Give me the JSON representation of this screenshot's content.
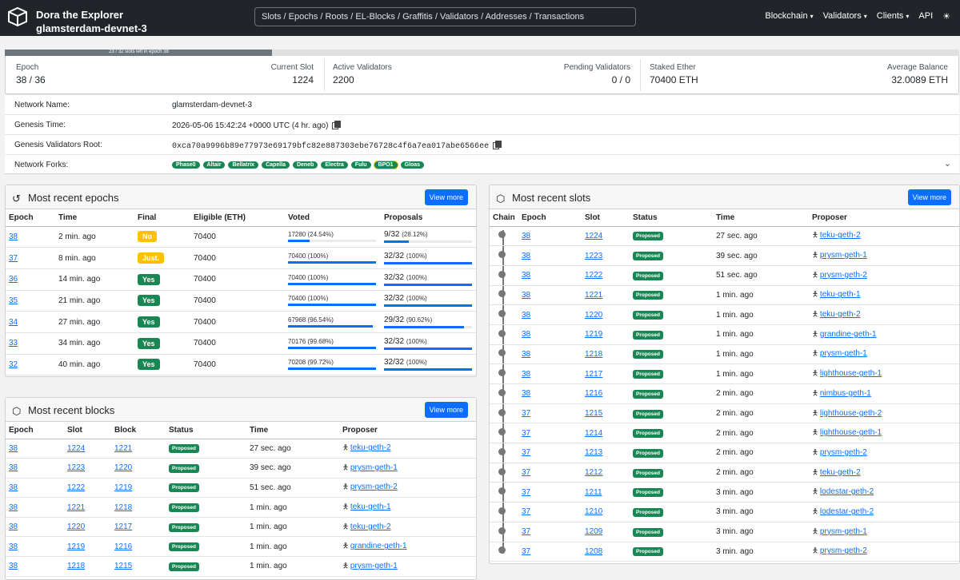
{
  "navbar": {
    "title": "Dora the Explorer",
    "network": "glamsterdam-devnet-3",
    "search_placeholder": "Slots / Epochs / Roots / EL-Blocks / Graffitis / Validators / Addresses / Transactions",
    "links": [
      "Blockchain",
      "Validators",
      "Clients",
      "API"
    ]
  },
  "epoch_progress": {
    "text": "23 / 32 slots left in epoch 38",
    "fraction": 0.28
  },
  "summary": {
    "epoch_label": "Epoch",
    "epoch_value": "38 / 36",
    "slot_label": "Current Slot",
    "slot_value": "1224",
    "active_label": "Active Validators",
    "active_value": "2200",
    "pending_label": "Pending Validators",
    "pending_value": "0 / 0",
    "staked_label": "Staked Ether",
    "staked_value": "70400 ETH",
    "balance_label": "Average Balance",
    "balance_value": "32.0089 ETH"
  },
  "network_info": {
    "name_label": "Network Name:",
    "name_value": "glamsterdam-devnet-3",
    "genesis_label": "Genesis Time:",
    "genesis_value": "2026-05-06 15:42:24 +0000 UTC (4 hr. ago)",
    "root_label": "Genesis Validators Root:",
    "root_value": "0xca70a9996b89e77973e69179bfc82e887303ebe76728c4f6a7ea017abe6566ee",
    "forks_label": "Network Forks:",
    "forks": [
      "Phase0",
      "Altair",
      "Bellatrix",
      "Capella",
      "Deneb",
      "Electra",
      "Fulu",
      "BPO1",
      "Gloas"
    ]
  },
  "epochs_panel": {
    "title": "Most recent epochs",
    "button": "View more",
    "headers": [
      "Epoch",
      "Time",
      "Final",
      "Eligible (ETH)",
      "Voted",
      "Proposals"
    ],
    "rows": [
      {
        "epoch": "38",
        "time": "2 min. ago",
        "final": "No",
        "eligible": "70400",
        "voted": "17280",
        "voted_pct": "(24.54%)",
        "voted_frac": 0.2454,
        "proposals": "9/32",
        "prop_pct": "(28.12%)",
        "prop_frac": 0.2812
      },
      {
        "epoch": "37",
        "time": "8 min. ago",
        "final": "Just.",
        "eligible": "70400",
        "voted": "70400",
        "voted_pct": "(100%)",
        "voted_frac": 1,
        "proposals": "32/32",
        "prop_pct": "(100%)",
        "prop_frac": 1
      },
      {
        "epoch": "36",
        "time": "14 min. ago",
        "final": "Yes",
        "eligible": "70400",
        "voted": "70400",
        "voted_pct": "(100%)",
        "voted_frac": 1,
        "proposals": "32/32",
        "prop_pct": "(100%)",
        "prop_frac": 1
      },
      {
        "epoch": "35",
        "time": "21 min. ago",
        "final": "Yes",
        "eligible": "70400",
        "voted": "70400",
        "voted_pct": "(100%)",
        "voted_frac": 1,
        "proposals": "32/32",
        "prop_pct": "(100%)",
        "prop_frac": 1
      },
      {
        "epoch": "34",
        "time": "27 min. ago",
        "final": "Yes",
        "eligible": "70400",
        "voted": "67968",
        "voted_pct": "(96.54%)",
        "voted_frac": 0.9654,
        "proposals": "29/32",
        "prop_pct": "(90.62%)",
        "prop_frac": 0.9062
      },
      {
        "epoch": "33",
        "time": "34 min. ago",
        "final": "Yes",
        "eligible": "70400",
        "voted": "70176",
        "voted_pct": "(99.68%)",
        "voted_frac": 0.9968,
        "proposals": "32/32",
        "prop_pct": "(100%)",
        "prop_frac": 1
      },
      {
        "epoch": "32",
        "time": "40 min. ago",
        "final": "Yes",
        "eligible": "70400",
        "voted": "70208",
        "voted_pct": "(99.72%)",
        "voted_frac": 0.9972,
        "proposals": "32/32",
        "prop_pct": "(100%)",
        "prop_frac": 1
      }
    ]
  },
  "blocks_panel": {
    "title": "Most recent blocks",
    "button": "View more",
    "headers": [
      "Epoch",
      "Slot",
      "Block",
      "Status",
      "Time",
      "Proposer"
    ],
    "rows": [
      {
        "epoch": "38",
        "slot": "1224",
        "block": "1221",
        "status": "Proposed",
        "time": "27 sec. ago",
        "proposer": "teku-geth-2"
      },
      {
        "epoch": "38",
        "slot": "1223",
        "block": "1220",
        "status": "Proposed",
        "time": "39 sec. ago",
        "proposer": "prysm-geth-1"
      },
      {
        "epoch": "38",
        "slot": "1222",
        "block": "1219",
        "status": "Proposed",
        "time": "51 sec. ago",
        "proposer": "prysm-geth-2"
      },
      {
        "epoch": "38",
        "slot": "1221",
        "block": "1218",
        "status": "Proposed",
        "time": "1 min. ago",
        "proposer": "teku-geth-1"
      },
      {
        "epoch": "38",
        "slot": "1220",
        "block": "1217",
        "status": "Proposed",
        "time": "1 min. ago",
        "proposer": "teku-geth-2"
      },
      {
        "epoch": "38",
        "slot": "1219",
        "block": "1216",
        "status": "Proposed",
        "time": "1 min. ago",
        "proposer": "grandine-geth-1"
      },
      {
        "epoch": "38",
        "slot": "1218",
        "block": "1215",
        "status": "Proposed",
        "time": "1 min. ago",
        "proposer": "prysm-geth-1"
      }
    ]
  },
  "slots_panel": {
    "title": "Most recent slots",
    "button": "View more",
    "headers": [
      "Chain",
      "Epoch",
      "Slot",
      "Status",
      "Time",
      "Proposer"
    ],
    "rows": [
      {
        "epoch": "38",
        "slot": "1224",
        "status": "Proposed",
        "time": "27 sec. ago",
        "proposer": "teku-geth-2"
      },
      {
        "epoch": "38",
        "slot": "1223",
        "status": "Proposed",
        "time": "39 sec. ago",
        "proposer": "prysm-geth-1"
      },
      {
        "epoch": "38",
        "slot": "1222",
        "status": "Proposed",
        "time": "51 sec. ago",
        "proposer": "prysm-geth-2"
      },
      {
        "epoch": "38",
        "slot": "1221",
        "status": "Proposed",
        "time": "1 min. ago",
        "proposer": "teku-geth-1"
      },
      {
        "epoch": "38",
        "slot": "1220",
        "status": "Proposed",
        "time": "1 min. ago",
        "proposer": "teku-geth-2"
      },
      {
        "epoch": "38",
        "slot": "1219",
        "status": "Proposed",
        "time": "1 min. ago",
        "proposer": "grandine-geth-1"
      },
      {
        "epoch": "38",
        "slot": "1218",
        "status": "Proposed",
        "time": "1 min. ago",
        "proposer": "prysm-geth-1"
      },
      {
        "epoch": "38",
        "slot": "1217",
        "status": "Proposed",
        "time": "1 min. ago",
        "proposer": "lighthouse-geth-1"
      },
      {
        "epoch": "38",
        "slot": "1216",
        "status": "Proposed",
        "time": "2 min. ago",
        "proposer": "nimbus-geth-1"
      },
      {
        "epoch": "37",
        "slot": "1215",
        "status": "Proposed",
        "time": "2 min. ago",
        "proposer": "lighthouse-geth-2"
      },
      {
        "epoch": "37",
        "slot": "1214",
        "status": "Proposed",
        "time": "2 min. ago",
        "proposer": "lighthouse-geth-1"
      },
      {
        "epoch": "37",
        "slot": "1213",
        "status": "Proposed",
        "time": "2 min. ago",
        "proposer": "prysm-geth-2"
      },
      {
        "epoch": "37",
        "slot": "1212",
        "status": "Proposed",
        "time": "2 min. ago",
        "proposer": "teku-geth-2"
      },
      {
        "epoch": "37",
        "slot": "1211",
        "status": "Proposed",
        "time": "3 min. ago",
        "proposer": "lodestar-geth-2"
      },
      {
        "epoch": "37",
        "slot": "1210",
        "status": "Proposed",
        "time": "3 min. ago",
        "proposer": "lodestar-geth-2"
      },
      {
        "epoch": "37",
        "slot": "1209",
        "status": "Proposed",
        "time": "3 min. ago",
        "proposer": "prysm-geth-1"
      },
      {
        "epoch": "37",
        "slot": "1208",
        "status": "Proposed",
        "time": "3 min. ago",
        "proposer": "prysm-geth-2"
      }
    ]
  }
}
